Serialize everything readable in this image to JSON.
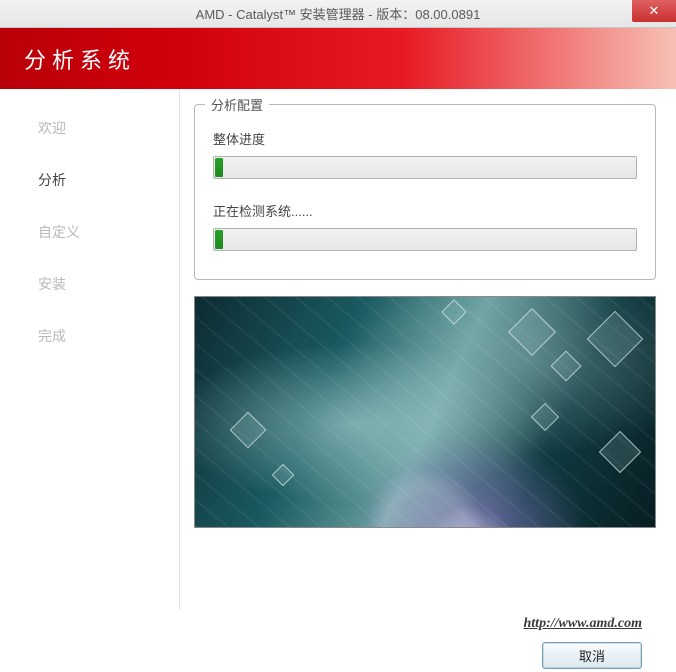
{
  "window": {
    "title": "AMD - Catalyst™ 安装管理器 - 版本：08.00.0891",
    "close_glyph": "✕"
  },
  "header": {
    "title": "分析系统"
  },
  "sidebar": {
    "steps": [
      {
        "label": "欢迎",
        "active": false
      },
      {
        "label": "分析",
        "active": true
      },
      {
        "label": "自定义",
        "active": false
      },
      {
        "label": "安装",
        "active": false
      },
      {
        "label": "完成",
        "active": false
      }
    ]
  },
  "analysis": {
    "group_title": "分析配置",
    "overall_label": "整体进度",
    "overall_percent": 2,
    "detect_label": "正在检测系统......",
    "detect_percent": 2
  },
  "footer": {
    "url": "http://www.amd.com",
    "cancel_label": "取消"
  }
}
